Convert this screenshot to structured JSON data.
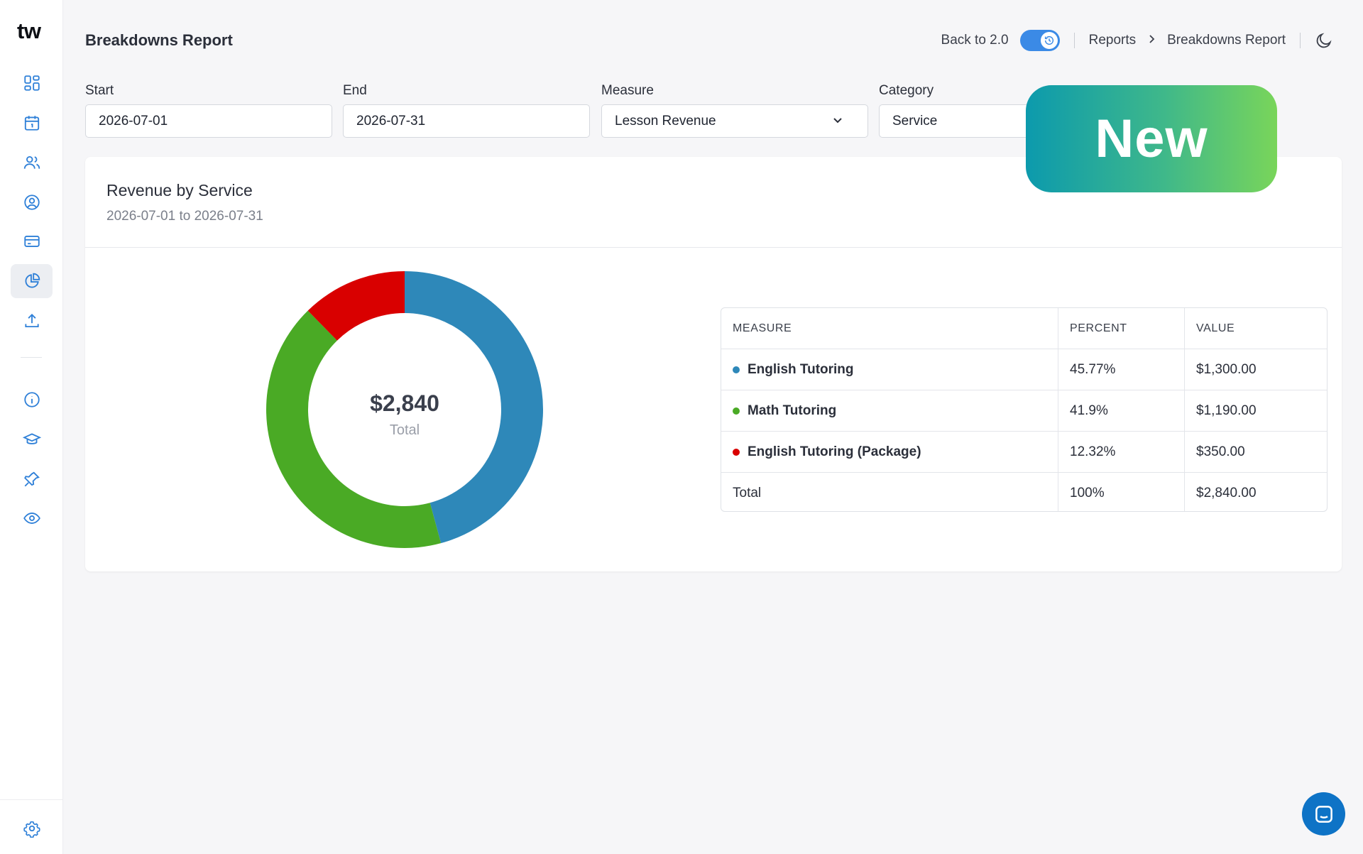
{
  "app": {
    "logo": "tw"
  },
  "sidebar": {
    "items": [
      {
        "icon": "dashboard-icon"
      },
      {
        "icon": "calendar-icon"
      },
      {
        "icon": "users-icon"
      },
      {
        "icon": "user-circle-icon"
      },
      {
        "icon": "credit-card-icon"
      },
      {
        "icon": "pie-chart-icon",
        "active": true
      },
      {
        "icon": "upload-icon"
      },
      {
        "icon": "info-icon"
      },
      {
        "icon": "graduation-cap-icon"
      },
      {
        "icon": "pin-icon"
      },
      {
        "icon": "eye-icon"
      }
    ],
    "settings_icon": "gear-icon"
  },
  "header": {
    "title": "Breakdowns Report",
    "back_label": "Back to 2.0",
    "breadcrumb": [
      "Reports",
      "Breakdowns Report"
    ],
    "theme_icon": "moon-icon"
  },
  "filters": {
    "start": {
      "label": "Start",
      "value": "2026-07-01"
    },
    "end": {
      "label": "End",
      "value": "2026-07-31"
    },
    "measure": {
      "label": "Measure",
      "value": "Lesson Revenue"
    },
    "category": {
      "label": "Category",
      "value": "Service"
    }
  },
  "badge": {
    "text": "New"
  },
  "card": {
    "title": "Revenue by Service",
    "subtitle": "2026-07-01 to 2026-07-31",
    "donut_total": "$2,840",
    "donut_label": "Total"
  },
  "table": {
    "headers": [
      "MEASURE",
      "PERCENT",
      "VALUE"
    ],
    "rows": [
      {
        "measure": "English Tutoring",
        "percent": "45.77%",
        "value": "$1,300.00",
        "color": "#2e88b9"
      },
      {
        "measure": "Math Tutoring",
        "percent": "41.9%",
        "value": "$1,190.00",
        "color": "#4aaa25"
      },
      {
        "measure": "English Tutoring (Package)",
        "percent": "12.32%",
        "value": "$350.00",
        "color": "#d90000"
      }
    ],
    "total": {
      "measure": "Total",
      "percent": "100%",
      "value": "$2,840.00"
    }
  },
  "chart_data": {
    "type": "pie",
    "categories": [
      "English Tutoring",
      "Math Tutoring",
      "English Tutoring (Package)"
    ],
    "values": [
      1300,
      1190,
      350
    ],
    "colors": [
      "#2e88b9",
      "#4aaa25",
      "#d90000"
    ],
    "title": "Revenue by Service"
  },
  "chat": {
    "icon": "chat-icon"
  }
}
